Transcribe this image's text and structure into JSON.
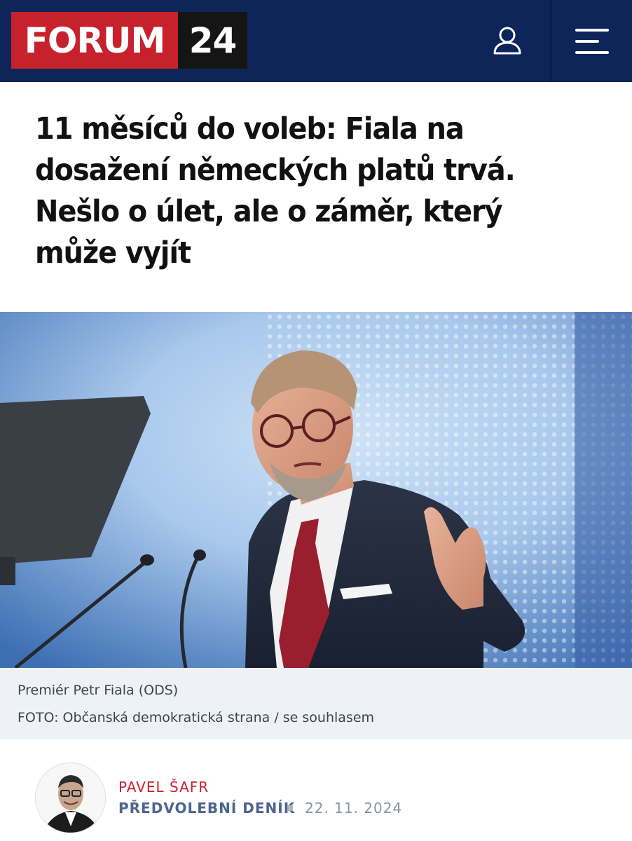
{
  "header": {
    "logo_word": "FORUM",
    "logo_number": "24",
    "brand_red": "#c8212e",
    "brand_navy": "#0d2559",
    "user_icon": "user-icon",
    "menu_icon": "hamburger-menu-icon"
  },
  "article": {
    "headline": "11 měsíců do voleb: Fiala na dosažení německých platů trvá. Nešlo o úlet, ale o záměr, který může vyjít",
    "caption": "Premiér Petr Fiala (ODS)",
    "photo_credit": "FOTO: Občanská demokratická strana / se souhlasem"
  },
  "author": {
    "name": "PAVEL ŠAFR",
    "rubric": "PŘEDVOLEBNÍ DENÍK",
    "date": "22. 11. 2024"
  }
}
